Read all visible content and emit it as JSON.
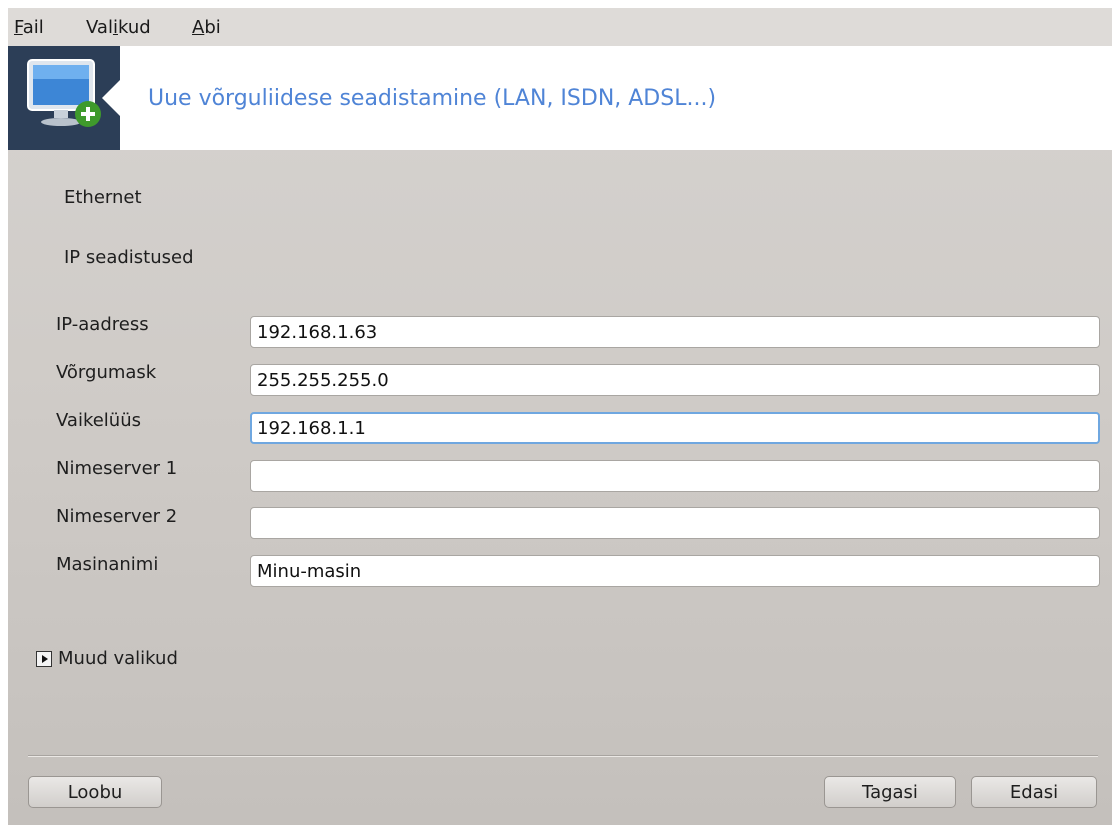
{
  "menubar": {
    "items": [
      {
        "prefix": "",
        "accel": "F",
        "rest": "ail"
      },
      {
        "prefix": "Val",
        "accel": "i",
        "rest": "kud"
      },
      {
        "prefix": "",
        "accel": "A",
        "rest": "bi"
      }
    ]
  },
  "banner": {
    "title": "Uue võrguliidese seadistamine (LAN, ISDN, ADSL...)",
    "icon": "network-monitor-add-icon"
  },
  "sections": {
    "ethernet": "Ethernet",
    "ip_settings": "IP seadistused"
  },
  "fields": [
    {
      "label": "IP-aadress",
      "value": "192.168.1.63"
    },
    {
      "label": "Võrgumask",
      "value": "255.255.255.0"
    },
    {
      "label": "Vaikelüüs",
      "value": "192.168.1.1"
    },
    {
      "label": "Nimeserver 1",
      "value": ""
    },
    {
      "label": "Nimeserver 2",
      "value": ""
    },
    {
      "label": "Masinanimi",
      "value": "Minu-masin"
    }
  ],
  "expander": {
    "label": "Muud valikud",
    "icon": "expander-arrow-icon"
  },
  "buttons": {
    "cancel": "Loobu",
    "back": "Tagasi",
    "next": "Edasi"
  },
  "colors": {
    "banner_title": "#4f84d6",
    "banner_icon_bg": "#2c3e57",
    "focus_border": "#6fa7e0"
  }
}
